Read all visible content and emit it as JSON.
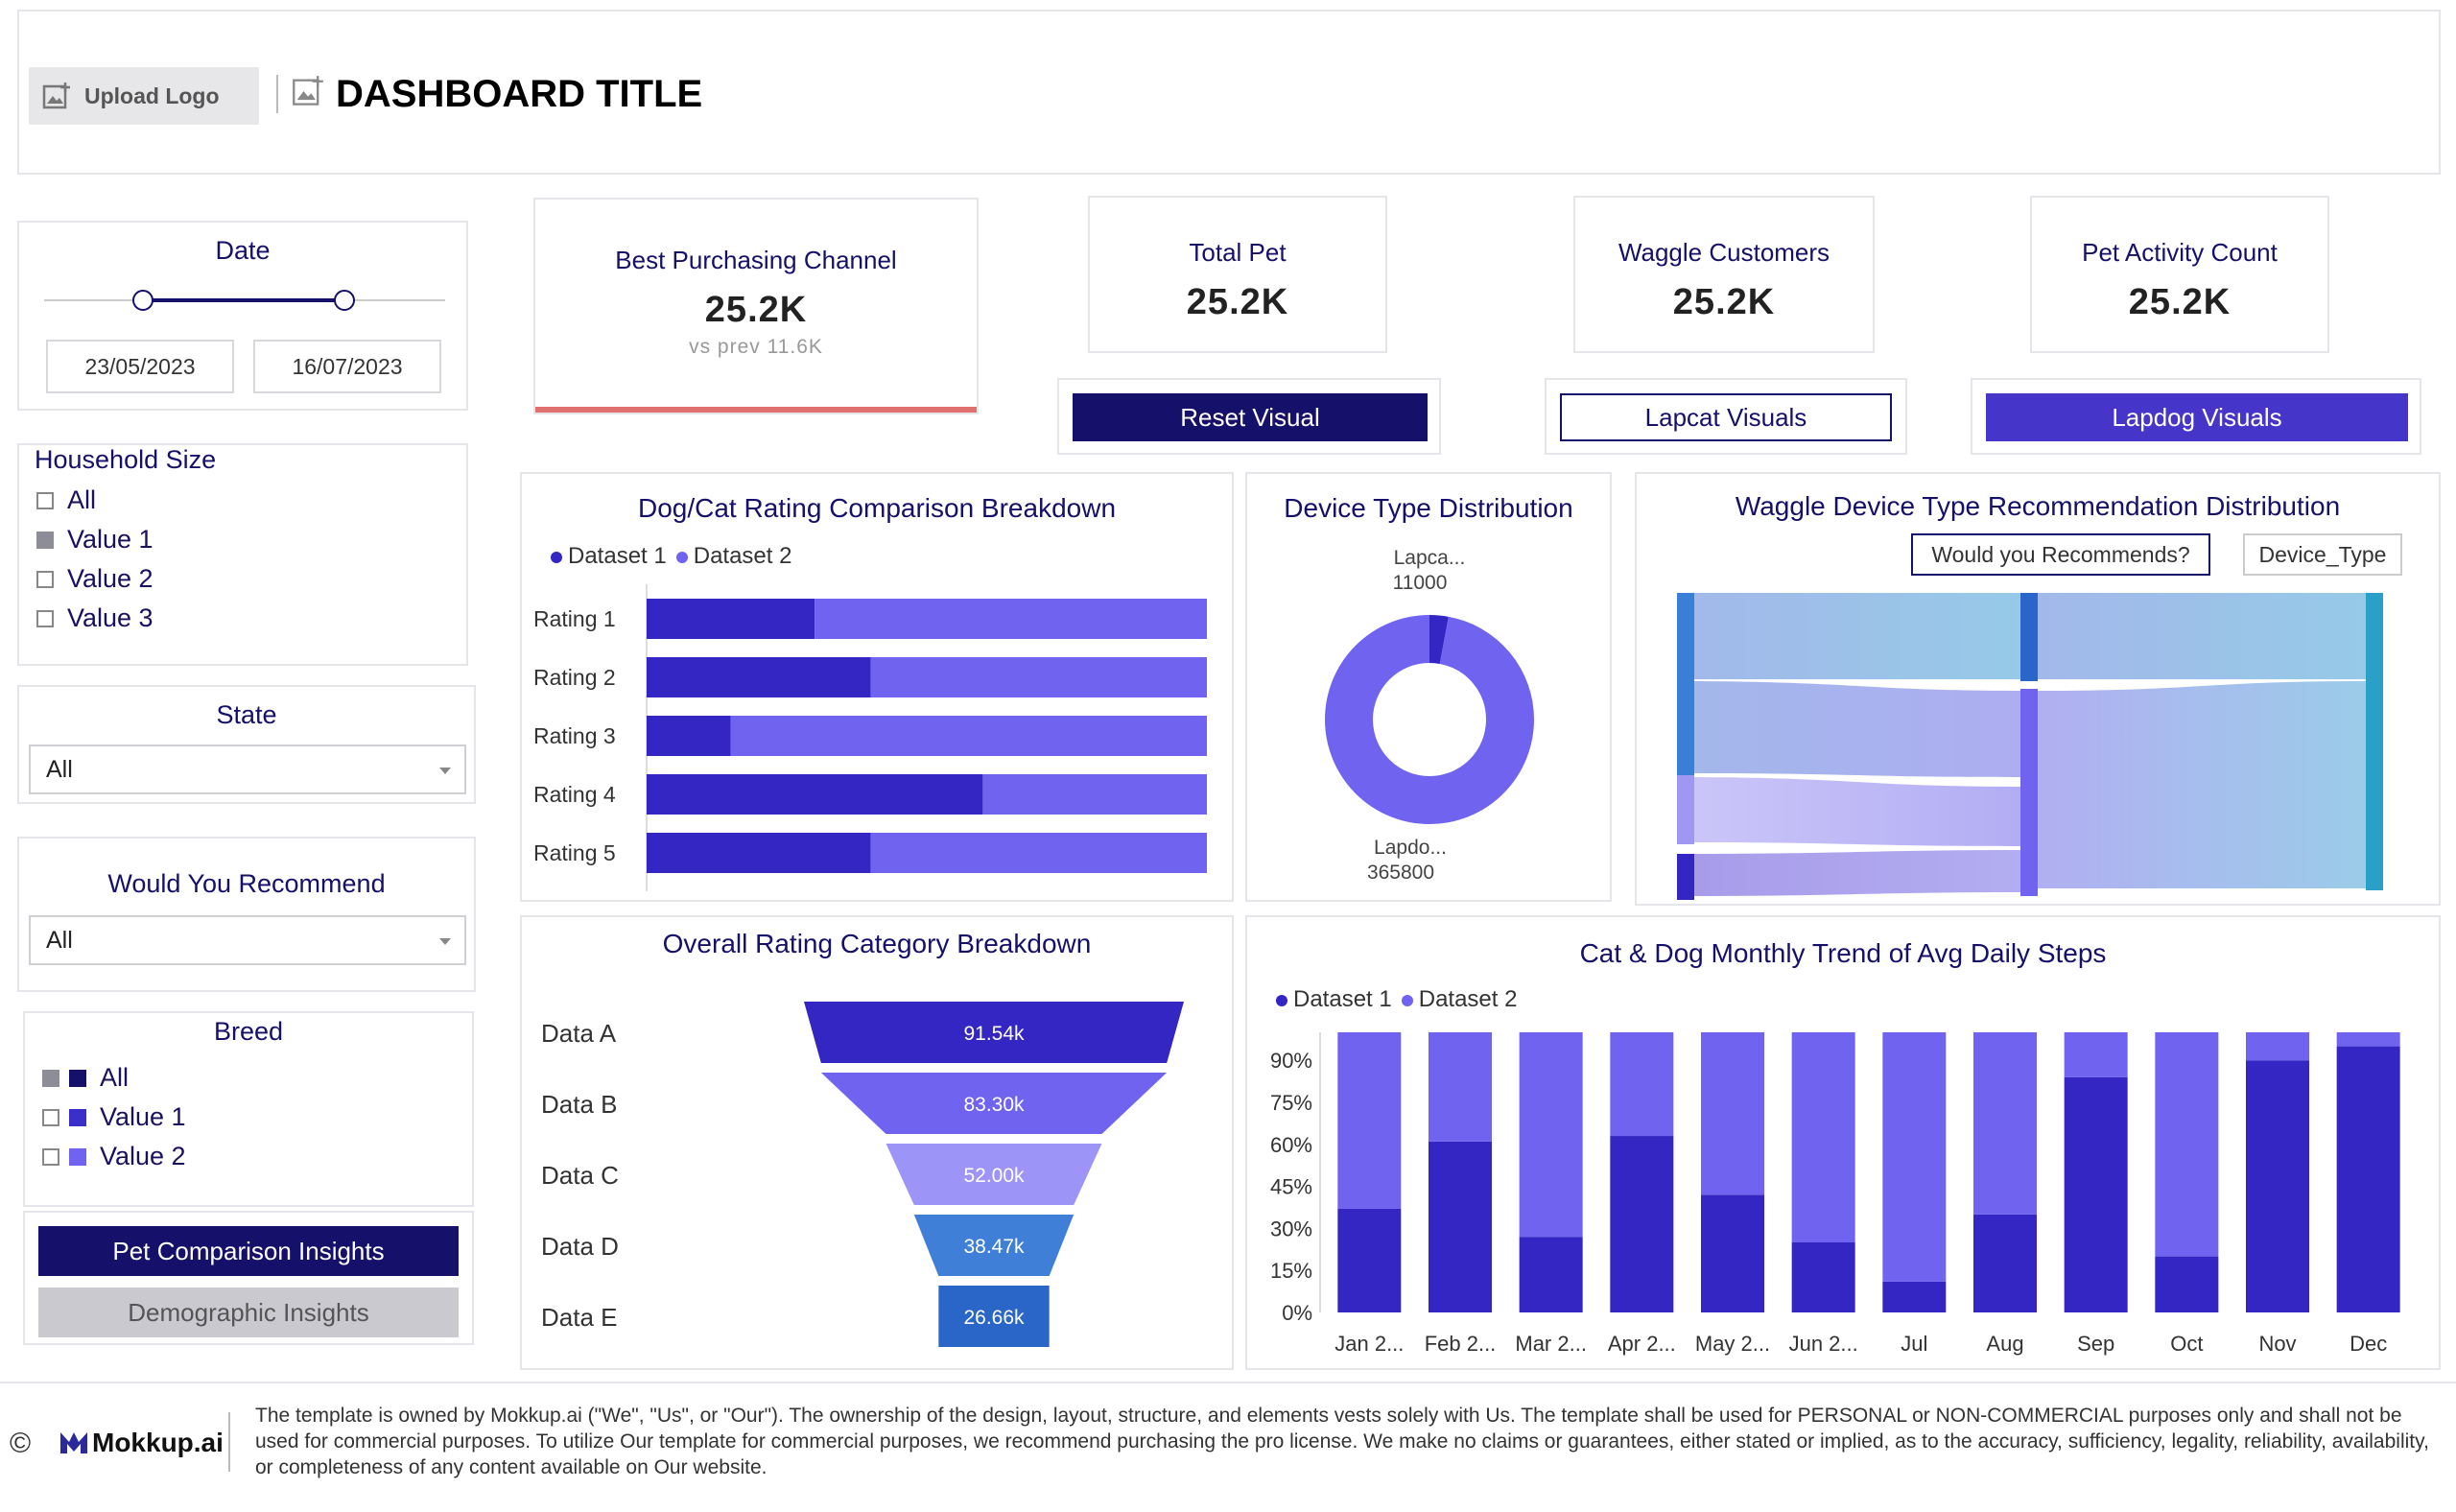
{
  "header": {
    "upload_logo_label": "Upload Logo",
    "title": "DASHBOARD TITLE"
  },
  "filters": {
    "date": {
      "title": "Date",
      "start": "23/05/2023",
      "end": "16/07/2023"
    },
    "household_size": {
      "title": "Household Size",
      "options": [
        {
          "label": "All",
          "checked": false
        },
        {
          "label": "Value 1",
          "checked": true
        },
        {
          "label": "Value 2",
          "checked": false
        },
        {
          "label": "Value 3",
          "checked": false
        }
      ]
    },
    "state": {
      "title": "State",
      "value": "All"
    },
    "would_you_recommend": {
      "title": "Would You Recommend",
      "value": "All"
    },
    "breed": {
      "title": "Breed",
      "options": [
        {
          "label": "All",
          "checked": true,
          "color": "#15106a"
        },
        {
          "label": "Value 1",
          "checked": false,
          "color": "#3a2fc8"
        },
        {
          "label": "Value 2",
          "checked": false,
          "color": "#6f63f0"
        }
      ]
    },
    "nav": {
      "pet_comparison": "Pet Comparison Insights",
      "demographic": "Demographic Insights"
    }
  },
  "kpis": {
    "best_channel": {
      "label": "Best Purchasing Channel",
      "value": "25.2K",
      "sub": "vs prev 11.6K"
    },
    "total_pet": {
      "label": "Total Pet",
      "value": "25.2K"
    },
    "waggle_customers": {
      "label": "Waggle Customers",
      "value": "25.2K"
    },
    "pet_activity": {
      "label": "Pet Activity Count",
      "value": "25.2K"
    }
  },
  "buttons": {
    "reset_visual": "Reset Visual",
    "lapcat_visuals": "Lapcat Visuals",
    "lapdog_visuals": "Lapdog Visuals"
  },
  "colors": {
    "navy": "#15106a",
    "dataset1": "#3326c2",
    "dataset2": "#6f63f0",
    "kpi_accent": "#e07070"
  },
  "charts": {
    "rating_breakdown_title": "Dog/Cat Rating Comparison Breakdown",
    "device_type_title": "Device Type Distribution",
    "sankey_title": "Waggle Device Type Recommendation Distribution",
    "sankey_tag1": "Would you Recommends?",
    "sankey_tag2": "Device_Type",
    "funnel_title": "Overall Rating Category Breakdown",
    "steps_title": "Cat & Dog Monthly Trend of Avg Daily Steps"
  },
  "chart_data": [
    {
      "type": "bar",
      "orientation": "horizontal",
      "stacked": true,
      "title": "Dog/Cat Rating Comparison Breakdown",
      "categories": [
        "Rating 1",
        "Rating 2",
        "Rating 3",
        "Rating 4",
        "Rating 5"
      ],
      "series": [
        {
          "name": "Dataset 1",
          "values": [
            30,
            40,
            15,
            60,
            40
          ]
        },
        {
          "name": "Dataset 2",
          "values": [
            70,
            60,
            85,
            40,
            60
          ]
        }
      ],
      "legend_position": "top-left"
    },
    {
      "type": "pie",
      "donut": true,
      "title": "Device Type Distribution",
      "slices": [
        {
          "label": "Lapca...",
          "value": 11000
        },
        {
          "label": "Lapdo...",
          "value": 365800
        }
      ],
      "value_labels": [
        "11000",
        "365800"
      ]
    },
    {
      "type": "funnel",
      "title": "Overall Rating Category Breakdown",
      "categories": [
        "Data A",
        "Data B",
        "Data C",
        "Data D",
        "Data E"
      ],
      "values": [
        91.54,
        83.3,
        52.0,
        38.47,
        26.66
      ],
      "value_labels": [
        "91.54k",
        "83.30k",
        "52.00k",
        "38.47k",
        "26.66k"
      ]
    },
    {
      "type": "bar",
      "stacked": true,
      "percent": true,
      "title": "Cat & Dog Monthly Trend of Avg Daily Steps",
      "categories": [
        "Jan 2...",
        "Feb 2...",
        "Mar 2...",
        "Apr 2...",
        "May 2...",
        "Jun 2...",
        "Jul",
        "Aug",
        "Sep",
        "Oct",
        "Nov",
        "Dec"
      ],
      "series": [
        {
          "name": "Dataset 1",
          "values": [
            37,
            61,
            27,
            63,
            42,
            25,
            11,
            35,
            84,
            20,
            90,
            95
          ]
        },
        {
          "name": "Dataset 2",
          "values": [
            63,
            39,
            73,
            37,
            58,
            75,
            89,
            65,
            16,
            80,
            10,
            5
          ]
        }
      ],
      "yticks": [
        "0%",
        "15%",
        "30%",
        "45%",
        "60%",
        "75%",
        "90%"
      ],
      "ylim": [
        0,
        100
      ],
      "legend_position": "top-left"
    }
  ],
  "footer": {
    "copyright": "©",
    "brand": "Mokkup.ai",
    "disclaimer": "The template is owned by Mokkup.ai (\"We\", \"Us\", or \"Our\"). The ownership of the design, layout, structure, and elements vests solely with Us. The template shall be used for PERSONAL or NON-COMMERCIAL purposes only and shall not be used for commercial purposes. To utilize Our template for commercial purposes, we recommend purchasing the pro license. We make no claims or guarantees, either stated or implied, as to the accuracy, sufficiency, legality, reliability, availability, or completeness of any content available on Our website."
  }
}
